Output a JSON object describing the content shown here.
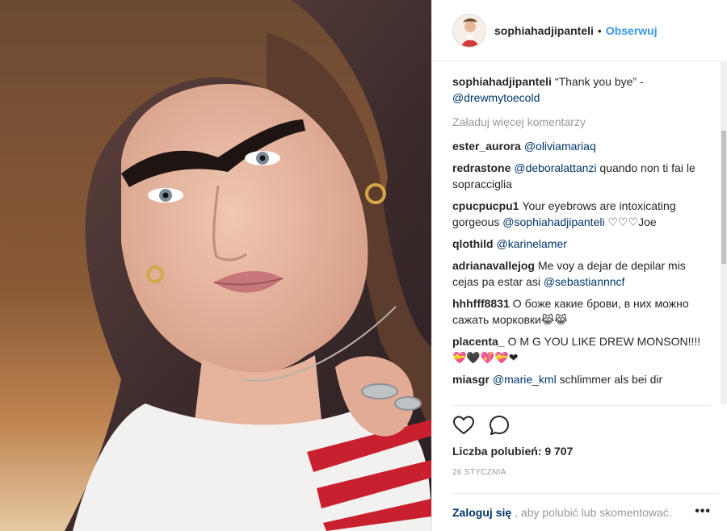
{
  "header": {
    "username": "sophiahadjipanteli",
    "separator": "•",
    "follow_label": "Obserwuj"
  },
  "caption": {
    "username": "sophiahadjipanteli",
    "text": "“Thank you bye” -",
    "mention": "@drewmytoecold"
  },
  "load_more_label": "Załaduj więcej komentarzy",
  "comments": [
    {
      "user": "ester_aurora",
      "parts": [
        {
          "t": "@oliviamariaq",
          "m": true
        }
      ]
    },
    {
      "user": "redrastone",
      "parts": [
        {
          "t": "@deboralattanzi",
          "m": true
        },
        {
          "t": " quando non ti fai le sopracciglia",
          "m": false
        }
      ]
    },
    {
      "user": "cpucpucpu1",
      "parts": [
        {
          "t": "Your eyebrows are intoxicating gorgeous ",
          "m": false
        },
        {
          "t": "@sophiahadjipanteli",
          "m": true
        },
        {
          "t": " ♡♡♡Joe",
          "m": false
        }
      ]
    },
    {
      "user": "qlothild",
      "parts": [
        {
          "t": "@karinelamer",
          "m": true
        }
      ]
    },
    {
      "user": "adrianavallejog",
      "parts": [
        {
          "t": "Me voy a dejar de depilar mis cejas pa estar asi ",
          "m": false
        },
        {
          "t": "@sebastiannncf",
          "m": true
        }
      ]
    },
    {
      "user": "hhhfff8831",
      "parts": [
        {
          "t": "О боже какие брови, в них можно сажать морковки😹😹",
          "m": false
        }
      ]
    },
    {
      "user": "placenta_",
      "parts": [
        {
          "t": "O M G YOU LIKE DREW MONSON!!!!💝🖤💖💝❤",
          "m": false
        }
      ]
    },
    {
      "user": "miasgr",
      "parts": [
        {
          "t": "@marie_kml",
          "m": true
        },
        {
          "t": " schlimmer als bei dir",
          "m": false
        }
      ]
    }
  ],
  "actions": {
    "like_icon": "heart-outline-icon",
    "comment_icon": "comment-bubble-icon"
  },
  "likes_text": "Liczba polubień: 9 707",
  "date_text": "26 STYCZNIA",
  "footer": {
    "login_label": "Zaloguj się",
    "rest_text": ", aby polubić lub skomentować.",
    "more_label": "•••"
  }
}
